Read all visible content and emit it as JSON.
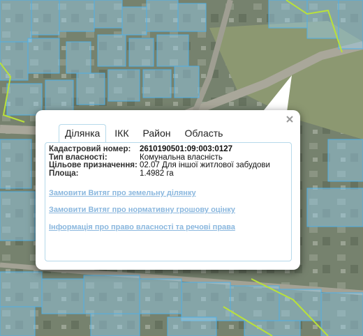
{
  "tabs": [
    "Ділянка",
    "ІКК",
    "Район",
    "Область"
  ],
  "active_tab": "Ділянка",
  "parcel": [
    {
      "key": "Кадастровий номер:",
      "value": "2610190501:09:003:0127"
    },
    {
      "key": "Тип власності:",
      "value": "Комунальна власність"
    },
    {
      "key": "Цільове призначення:",
      "value": "02.07 Для іншої житлової забудови"
    },
    {
      "key": "Площа:",
      "value": "1.4982 га"
    }
  ],
  "links": {
    "order_extract": "Замовити Витяг про земельну ділянку",
    "order_valuation": "Замовити Витяг про нормативну грошову оцінку",
    "ownership_info": "Інформація про право власності та речові права"
  },
  "icons": {
    "close": "close-icon"
  },
  "colors": {
    "parcel_fill": "#9ad0f0",
    "parcel_stroke": "#4fb0e6",
    "boundary": "#b9e13a",
    "link": "#8ab7de",
    "panel_border": "#b6d9ea"
  }
}
